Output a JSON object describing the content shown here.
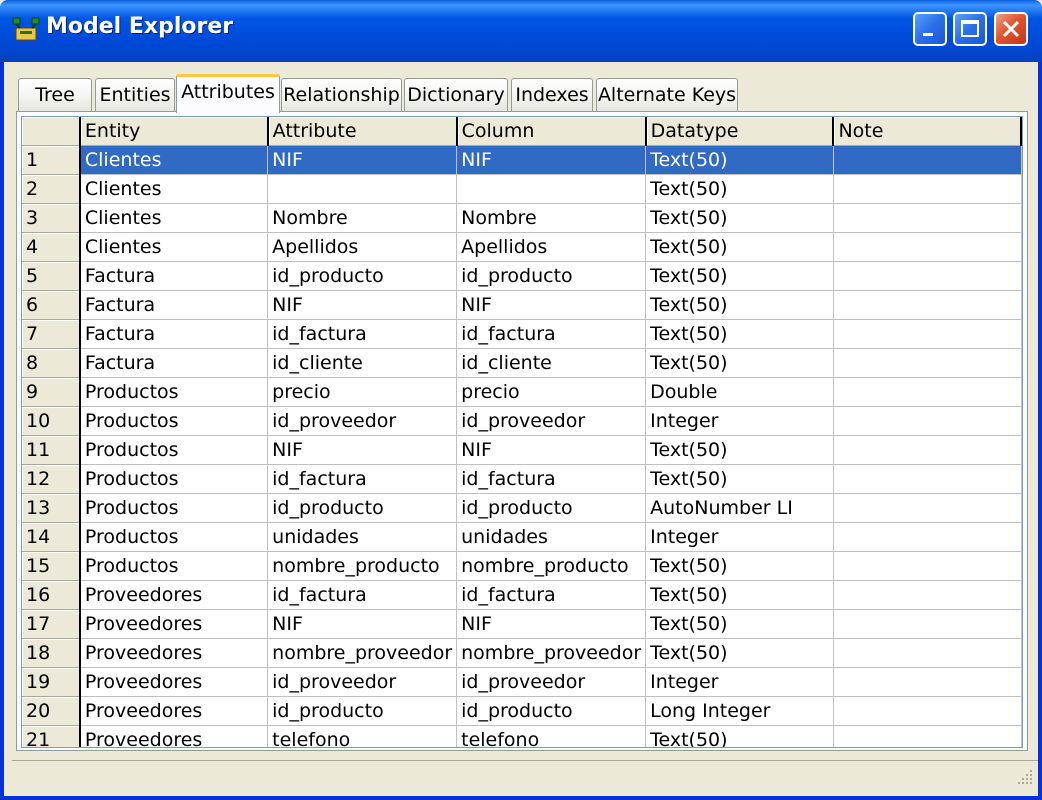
{
  "window": {
    "title": "Model Explorer"
  },
  "tabs": [
    {
      "label": "Tree"
    },
    {
      "label": "Entities"
    },
    {
      "label": "Attributes",
      "active": true
    },
    {
      "label": "Relationship"
    },
    {
      "label": "Dictionary"
    },
    {
      "label": "Indexes"
    },
    {
      "label": "Alternate Keys"
    }
  ],
  "grid": {
    "columns": [
      "Entity",
      "Attribute",
      "Column",
      "Datatype",
      "Note"
    ],
    "selected_row": 1,
    "rows": [
      {
        "n": "1",
        "entity": "Clientes",
        "attribute": "NIF",
        "column": "NIF",
        "datatype": "Text(50)",
        "note": ""
      },
      {
        "n": "2",
        "entity": "Clientes",
        "attribute": "",
        "column": "",
        "datatype": "Text(50)",
        "note": ""
      },
      {
        "n": "3",
        "entity": "Clientes",
        "attribute": "Nombre",
        "column": "Nombre",
        "datatype": "Text(50)",
        "note": ""
      },
      {
        "n": "4",
        "entity": "Clientes",
        "attribute": "Apellidos",
        "column": "Apellidos",
        "datatype": "Text(50)",
        "note": ""
      },
      {
        "n": "5",
        "entity": "Factura",
        "attribute": "id_producto",
        "column": "id_producto",
        "datatype": "Text(50)",
        "note": ""
      },
      {
        "n": "6",
        "entity": "Factura",
        "attribute": "NIF",
        "column": "NIF",
        "datatype": "Text(50)",
        "note": ""
      },
      {
        "n": "7",
        "entity": "Factura",
        "attribute": "id_factura",
        "column": "id_factura",
        "datatype": "Text(50)",
        "note": ""
      },
      {
        "n": "8",
        "entity": "Factura",
        "attribute": "id_cliente",
        "column": "id_cliente",
        "datatype": "Text(50)",
        "note": ""
      },
      {
        "n": "9",
        "entity": "Productos",
        "attribute": "precio",
        "column": "precio",
        "datatype": "Double",
        "note": ""
      },
      {
        "n": "10",
        "entity": "Productos",
        "attribute": "id_proveedor",
        "column": "id_proveedor",
        "datatype": "Integer",
        "note": ""
      },
      {
        "n": "11",
        "entity": "Productos",
        "attribute": "NIF",
        "column": "NIF",
        "datatype": "Text(50)",
        "note": ""
      },
      {
        "n": "12",
        "entity": "Productos",
        "attribute": "id_factura",
        "column": "id_factura",
        "datatype": "Text(50)",
        "note": ""
      },
      {
        "n": "13",
        "entity": "Productos",
        "attribute": "id_producto",
        "column": "id_producto",
        "datatype": "AutoNumber LI",
        "note": ""
      },
      {
        "n": "14",
        "entity": "Productos",
        "attribute": "unidades",
        "column": "unidades",
        "datatype": "Integer",
        "note": ""
      },
      {
        "n": "15",
        "entity": "Productos",
        "attribute": "nombre_producto",
        "column": "nombre_producto",
        "datatype": "Text(50)",
        "note": ""
      },
      {
        "n": "16",
        "entity": "Proveedores",
        "attribute": "id_factura",
        "column": "id_factura",
        "datatype": "Text(50)",
        "note": ""
      },
      {
        "n": "17",
        "entity": "Proveedores",
        "attribute": "NIF",
        "column": "NIF",
        "datatype": "Text(50)",
        "note": ""
      },
      {
        "n": "18",
        "entity": "Proveedores",
        "attribute": "nombre_proveedor",
        "column": "nombre_proveedor",
        "datatype": "Text(50)",
        "note": ""
      },
      {
        "n": "19",
        "entity": "Proveedores",
        "attribute": "id_proveedor",
        "column": "id_proveedor",
        "datatype": "Integer",
        "note": ""
      },
      {
        "n": "20",
        "entity": "Proveedores",
        "attribute": "id_producto",
        "column": "id_producto",
        "datatype": "Long Integer",
        "note": ""
      },
      {
        "n": "21",
        "entity": "Proveedores",
        "attribute": "telefono",
        "column": "telefono",
        "datatype": "Text(50)",
        "note": ""
      }
    ]
  },
  "colors": {
    "titlebar": "#0055e5",
    "selection": "#316ac5",
    "active_tab_accent": "#ffc83c"
  },
  "icons": [
    "app-icon",
    "minimize-icon",
    "maximize-icon",
    "close-icon",
    "resize-grip-icon"
  ]
}
